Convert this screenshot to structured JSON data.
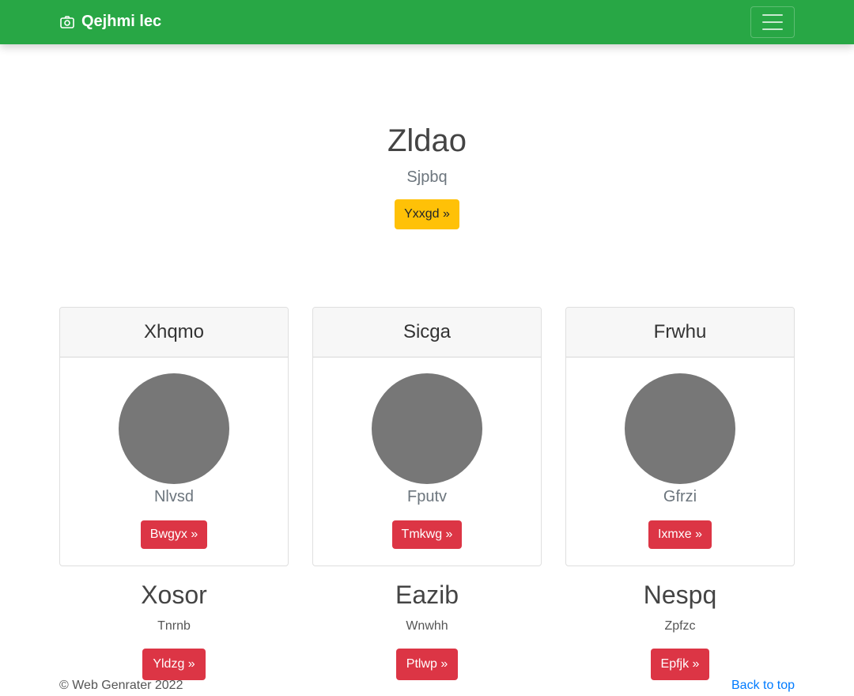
{
  "navbar": {
    "brand_icon": "camera-icon",
    "brand_text": "Qejhmi lec",
    "toggler_icon": "hamburger-menu-icon"
  },
  "hero": {
    "title": "Zldao",
    "lead": "Sjpbq",
    "button_label": "Yxxgd »"
  },
  "cards": [
    {
      "header": "Xhqmo",
      "text": "Nlvsd",
      "button_label": "Bwgyx »"
    },
    {
      "header": "Sicga",
      "text": "Fputv",
      "button_label": "Tmkwg »"
    },
    {
      "header": "Frwhu",
      "text": "Gfrzi",
      "button_label": "Ixmxe »"
    }
  ],
  "columns": [
    {
      "title": "Xosor",
      "text": "Tnrnb",
      "button_label": "Yldzg »"
    },
    {
      "title": "Eazib",
      "text": "Wnwhh",
      "button_label": "Ptlwp »"
    },
    {
      "title": "Nespq",
      "text": "Zpfzc",
      "button_label": "Epfjk »"
    }
  ],
  "footer": {
    "copyright": "© Web Genrater 2022",
    "back_to_top": "Back to top"
  },
  "colors": {
    "navbar": "#28a745",
    "warning": "#ffc107",
    "danger": "#dc3545",
    "link": "#007bff",
    "avatar": "#777777"
  }
}
